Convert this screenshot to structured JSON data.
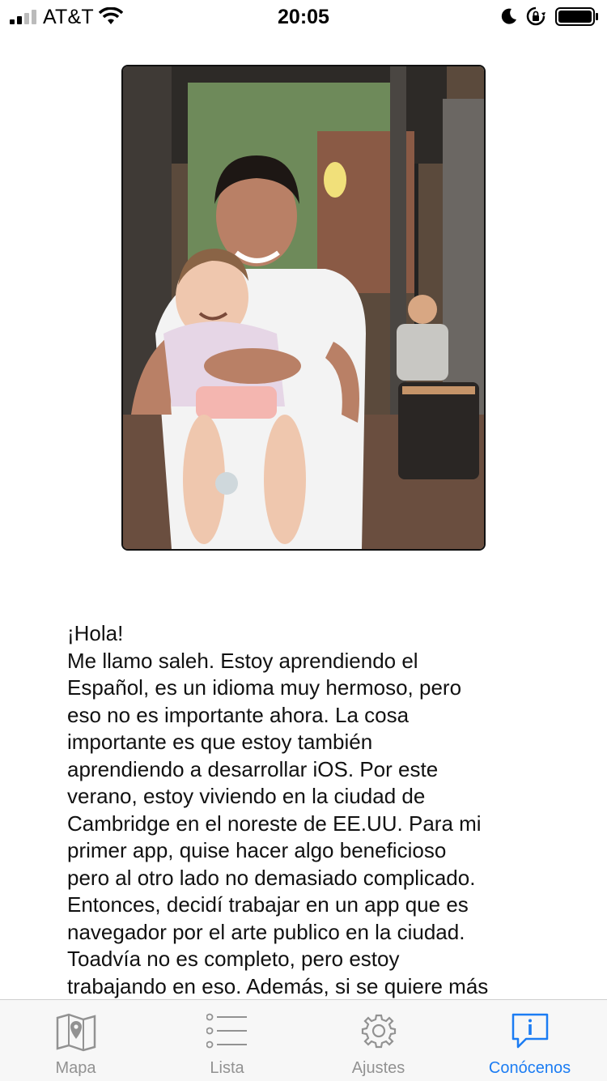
{
  "status_bar": {
    "carrier": "AT&T",
    "time": "20:05",
    "icons": [
      "signal-icon",
      "wifi-icon",
      "moon-icon",
      "rotation-lock-icon",
      "battery-icon"
    ]
  },
  "photo": {
    "description_icon": "profile-photo"
  },
  "about": {
    "greeting": "¡Hola!",
    "body": "Me llamo saleh. Estoy aprendiendo el\nEspañol, es un idioma muy hermoso, pero\neso no es importante ahora. La cosa\nimportante es que estoy también\naprendiendo a desarrollar iOS. Por este\nverano, estoy viviendo en la ciudad de\nCambridge en el noreste de EE.UU. Para mi\nprimer app, quise hacer algo beneficioso\npero al otro lado no demasiado complicado.\nEntonces, decidí trabajar en un app que es\nnavegador por el arte publico en la ciudad.\nToadvía no es completo, pero estoy\ntrabajando en eso. Además, si se quiere más"
  },
  "tab_bar": {
    "tabs": [
      {
        "label": "Mapa",
        "icon": "map-icon",
        "active": false
      },
      {
        "label": "Lista",
        "icon": "list-icon",
        "active": false
      },
      {
        "label": "Ajustes",
        "icon": "gear-icon",
        "active": false
      },
      {
        "label": "Conócenos",
        "icon": "info-bubble-icon",
        "active": true
      }
    ],
    "active_color": "#1b7cf3",
    "inactive_color": "#929292"
  }
}
